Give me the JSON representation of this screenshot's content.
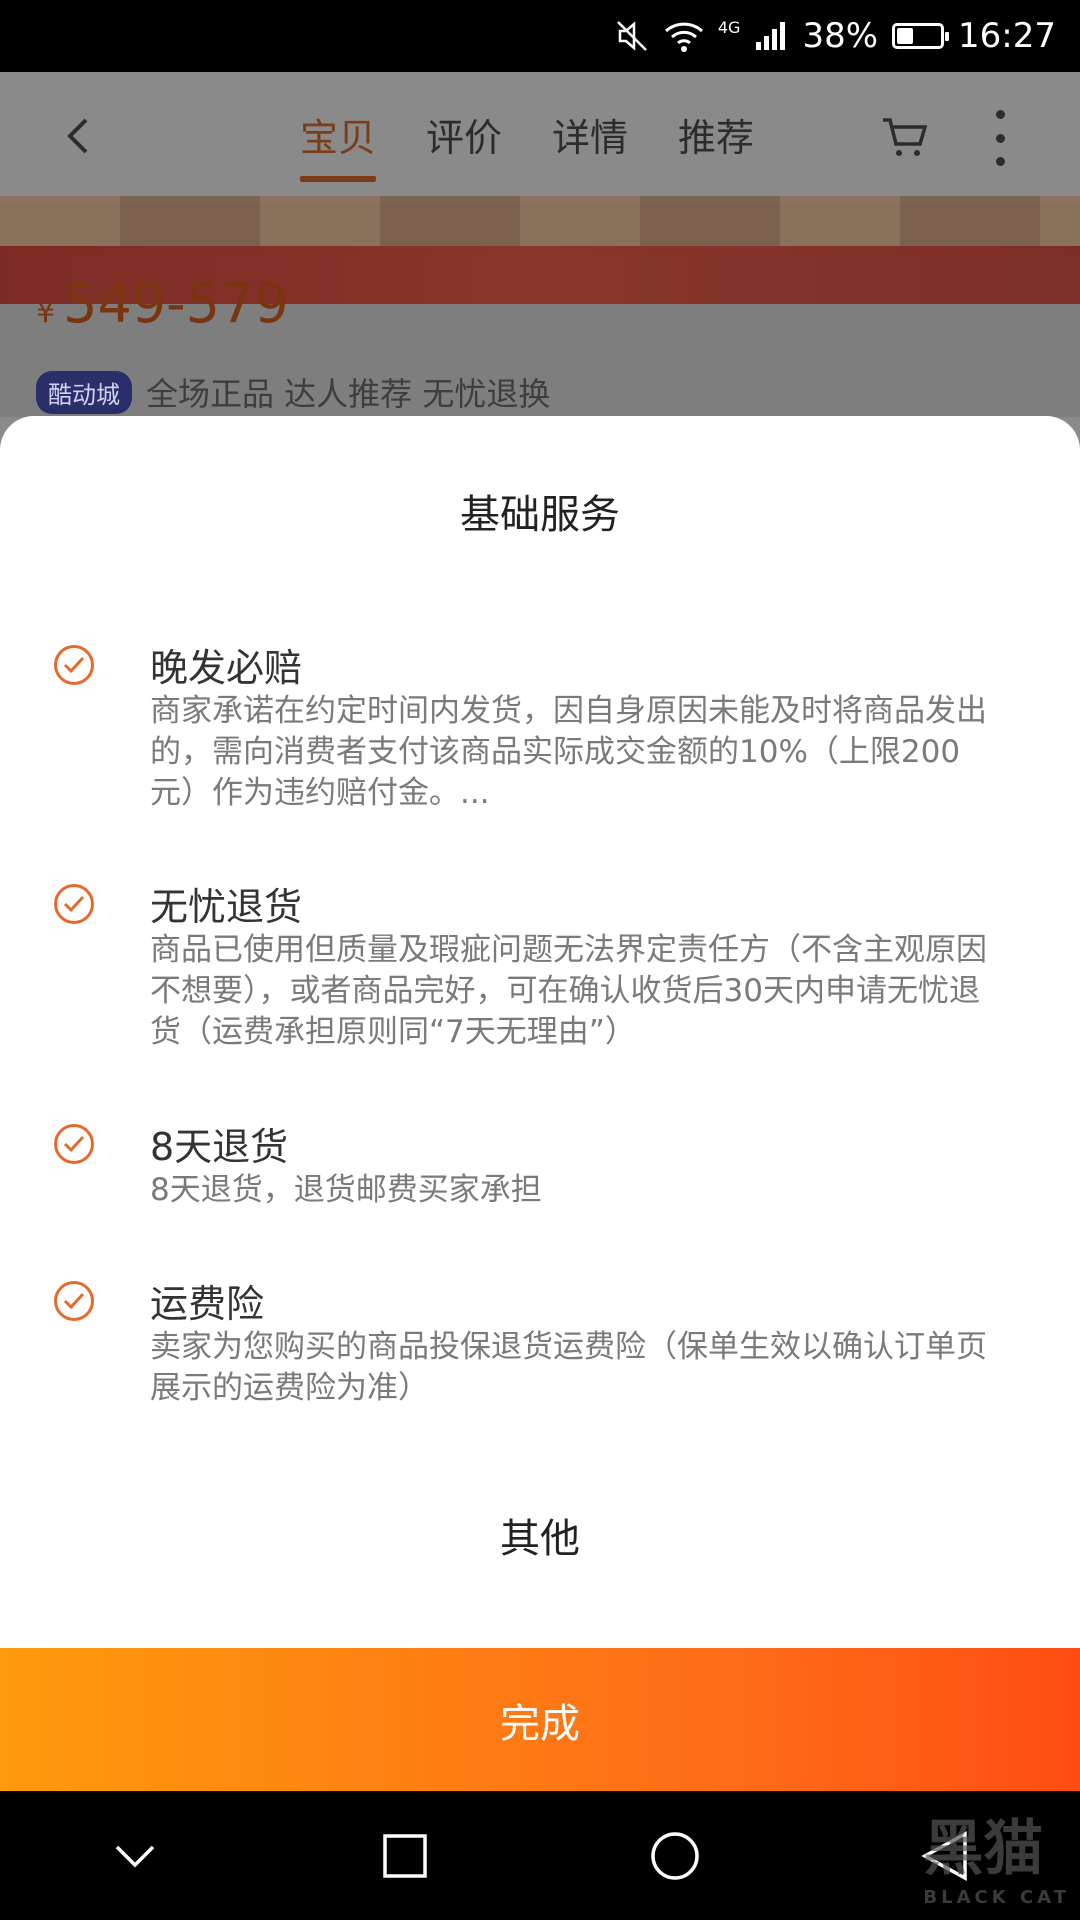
{
  "status_bar": {
    "network": "4G",
    "battery": "38%",
    "time": "16:27"
  },
  "background_page": {
    "tabs": [
      "宝贝",
      "评价",
      "详情",
      "推荐"
    ],
    "active_tab": "宝贝",
    "price_symbol": "¥",
    "price": "549-579",
    "tag_badge": "酷动城",
    "tag_text": "全场正品 达人推荐 无忧退换"
  },
  "sheet": {
    "title": "基础服务",
    "services": [
      {
        "title": "晚发必赔",
        "desc": "商家承诺在约定时间内发货，因自身原因未能及时将商品发出的，需向消费者支付该商品实际成交金额的10%（上限200元）作为违约赔付金。..."
      },
      {
        "title": "无忧退货",
        "desc": "商品已使用但质量及瑕疵问题无法界定责任方（不含主观原因不想要），或者商品完好，可在确认收货后30天内申请无忧退货（运费承担原则同“7天无理由”）"
      },
      {
        "title": "8天退货",
        "desc": "8天退货，退货邮费买家承担"
      },
      {
        "title": "运费险",
        "desc": "卖家为您购买的商品投保退货运费险（保单生效以确认订单页展示的运费险为准）"
      }
    ],
    "other": "其他"
  },
  "done_button": "完成",
  "watermark": {
    "cn": "黑猫",
    "en": "BLACK CAT"
  },
  "colors": {
    "accent": "#e8692c",
    "button_start": "#ff9a0c",
    "button_end": "#ff4d12"
  }
}
